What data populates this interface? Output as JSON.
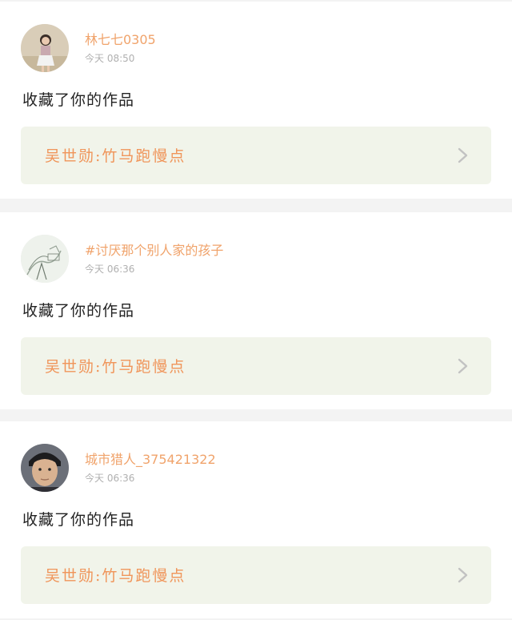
{
  "notifications": [
    {
      "username": "林七七0305",
      "time": "今天 08:50",
      "message": "收藏了你的作品",
      "work_title": "吴世勋:竹马跑慢点",
      "avatar_icon": "avatar-girl-photo"
    },
    {
      "username": "#讨厌那个别人家的孩子",
      "time": "今天 06:36",
      "message": "收藏了你的作品",
      "work_title": "吴世勋:竹马跑慢点",
      "avatar_icon": "avatar-sketch-drawing"
    },
    {
      "username": "城市猎人_375421322",
      "time": "今天 06:36",
      "message": "收藏了你的作品",
      "work_title": "吴世勋:竹马跑慢点",
      "avatar_icon": "avatar-boy-photo"
    }
  ],
  "colors": {
    "username": "#f0a36b",
    "work_title": "#f0955a",
    "work_box_bg": "#f1f4ea",
    "time": "#b0b0b0",
    "page_bg": "#f3f3f3"
  }
}
